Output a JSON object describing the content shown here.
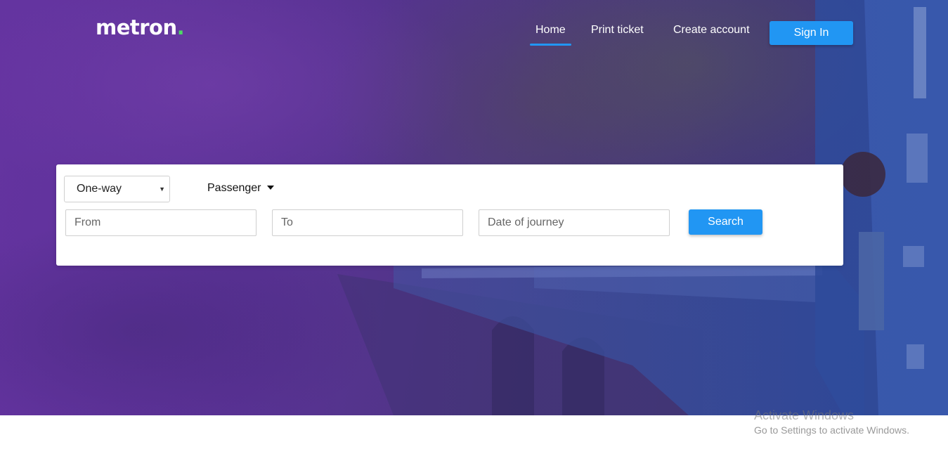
{
  "brand": {
    "name": "metron",
    "dot": ".",
    "accent_color": "#4cd964"
  },
  "nav": {
    "items": [
      {
        "label": "Home",
        "active": true
      },
      {
        "label": "Print ticket",
        "active": false
      },
      {
        "label": "Create account",
        "active": false
      }
    ],
    "signin_label": "Sign In",
    "accent_color": "#2196f3"
  },
  "search": {
    "trip_type": "One-way",
    "passenger_label": "Passenger",
    "from_placeholder": "From",
    "to_placeholder": "To",
    "date_placeholder": "Date of journey",
    "search_label": "Search"
  },
  "watermark": {
    "title": "Activate Windows",
    "subtitle": "Go to Settings to activate Windows."
  }
}
